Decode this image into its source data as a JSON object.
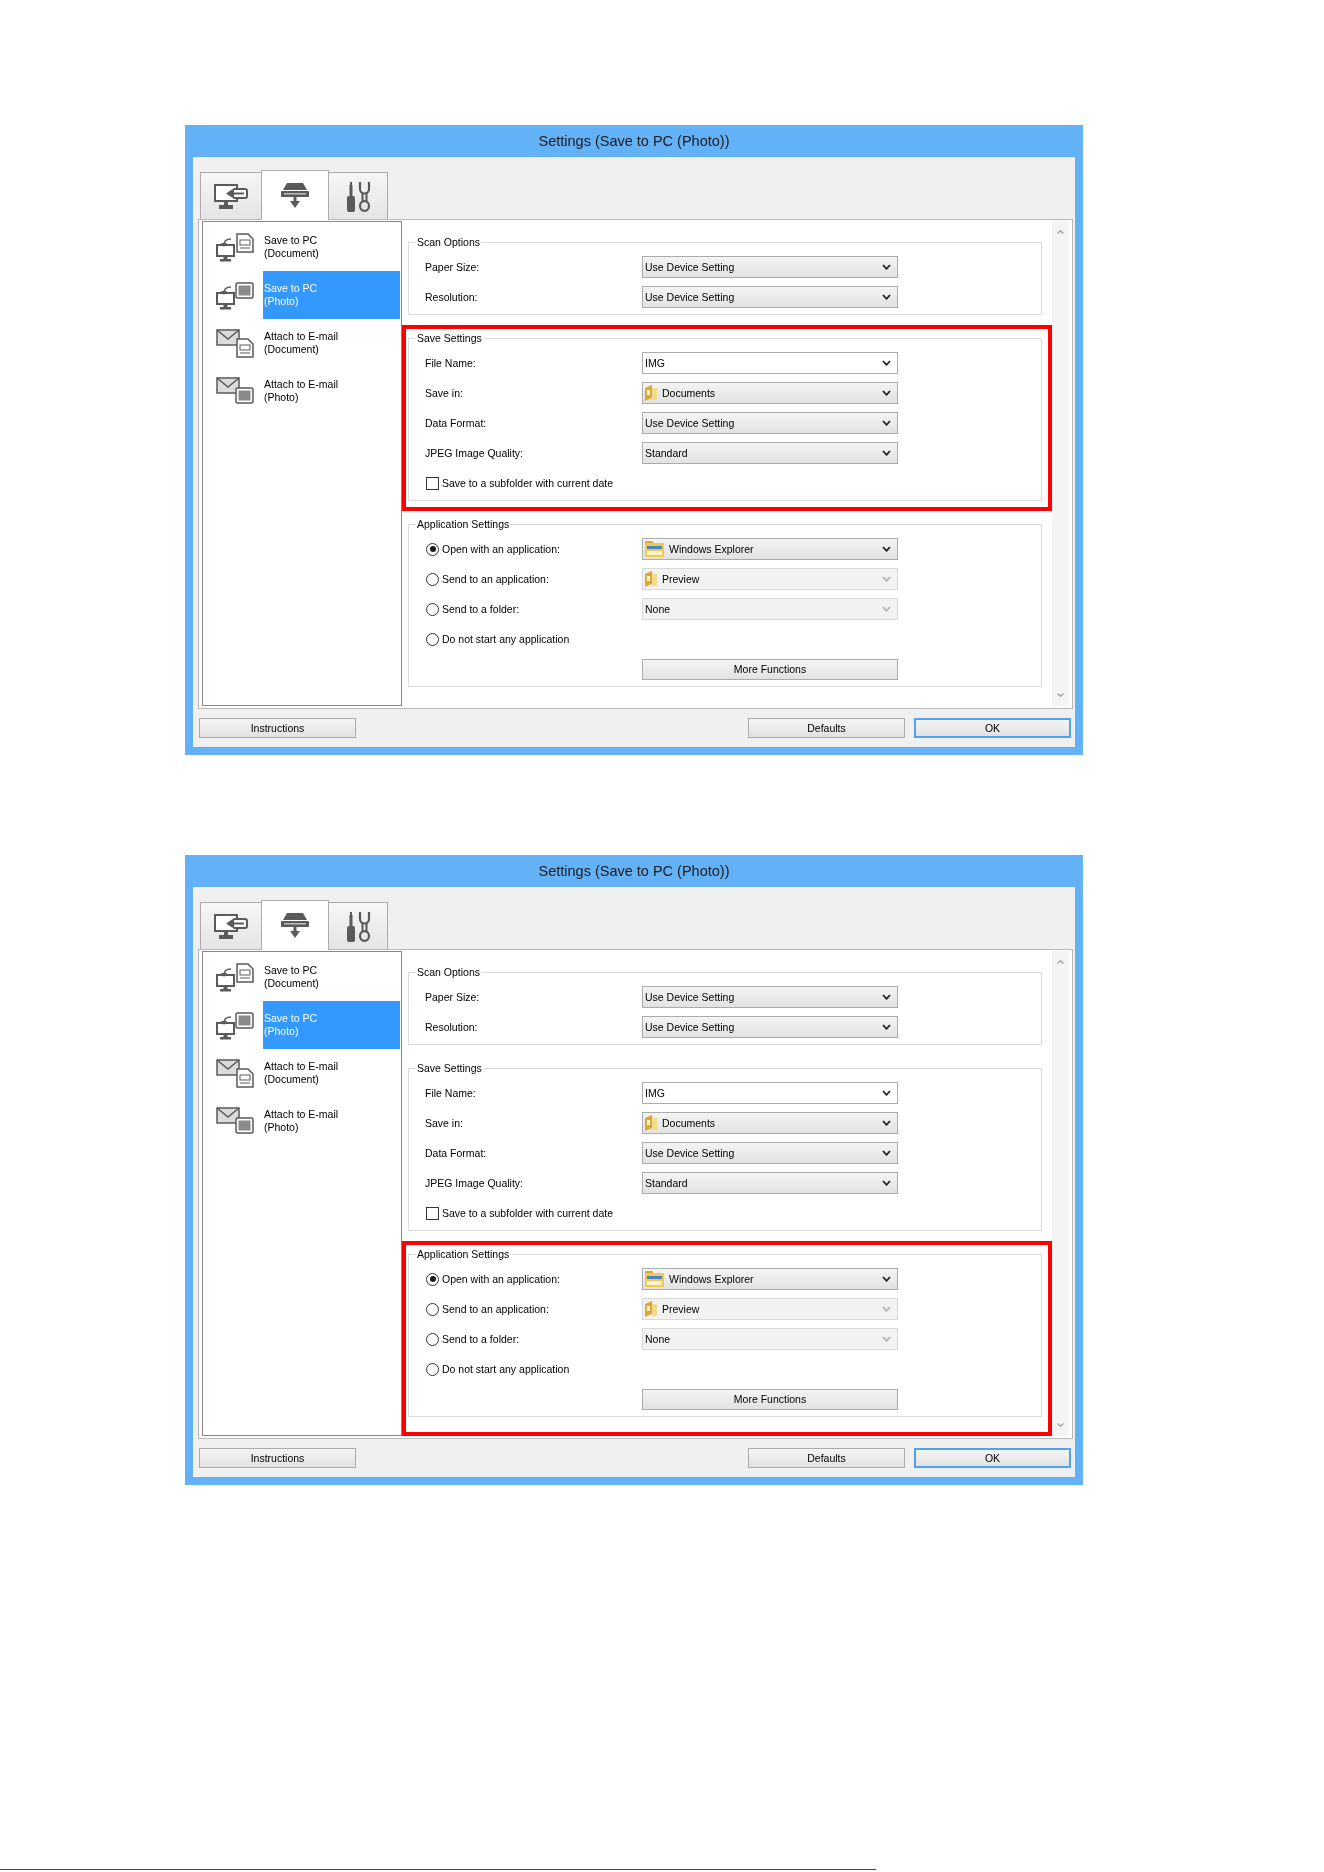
{
  "screens": [
    {
      "window": {
        "title": "Settings (Save to PC (Photo))"
      },
      "tabs": [
        {
          "selected": false
        },
        {
          "selected": true
        },
        {
          "selected": false
        }
      ],
      "sidebar": {
        "items": [
          {
            "title": "Save to PC",
            "subtitle": "(Document)",
            "selected": false
          },
          {
            "title": "Save to PC",
            "subtitle": "(Photo)",
            "selected": true
          },
          {
            "title": "Attach to E-mail",
            "subtitle": "(Document)",
            "selected": false
          },
          {
            "title": "Attach to E-mail",
            "subtitle": "(Photo)",
            "selected": false
          }
        ]
      },
      "scan_options": {
        "title": "Scan Options",
        "highlighted": false,
        "fields": [
          {
            "label": "Paper Size:",
            "kind": "select",
            "value": "Use Device Setting"
          },
          {
            "label": "Resolution:",
            "kind": "select",
            "value": "Use Device Setting"
          }
        ]
      },
      "save_settings": {
        "title": "Save Settings",
        "highlighted": true,
        "fields": [
          {
            "label": "File Name:",
            "kind": "editable",
            "value": "IMG"
          },
          {
            "label": "Save in:",
            "kind": "folder",
            "value": "Documents"
          },
          {
            "label": "Data Format:",
            "kind": "select",
            "value": "Use Device Setting"
          },
          {
            "label": "JPEG Image Quality:",
            "kind": "select",
            "value": "Standard"
          }
        ],
        "checkbox": {
          "label": "Save to a subfolder with current date",
          "checked": false
        }
      },
      "application_settings": {
        "title": "Application Settings",
        "highlighted": false,
        "options": [
          {
            "label": "Open with an application:",
            "selected": true,
            "dropdown": {
              "kind": "explorer",
              "value": "Windows Explorer",
              "disabled": false
            }
          },
          {
            "label": "Send to an application:",
            "selected": false,
            "dropdown": {
              "kind": "folder",
              "value": "Preview",
              "disabled": true
            }
          },
          {
            "label": "Send to a folder:",
            "selected": false,
            "dropdown": {
              "kind": "select",
              "value": "None",
              "disabled": true
            }
          },
          {
            "label": "Do not start any application",
            "selected": false
          }
        ],
        "button": "More Functions"
      },
      "buttons": [
        {
          "label": "Instructions",
          "default": false
        },
        {
          "label": "Defaults",
          "default": false
        },
        {
          "label": "OK",
          "default": true
        }
      ]
    },
    {
      "window": {
        "title": "Settings (Save to PC (Photo))"
      },
      "tabs": [
        {
          "selected": false
        },
        {
          "selected": true
        },
        {
          "selected": false
        }
      ],
      "sidebar": {
        "items": [
          {
            "title": "Save to PC",
            "subtitle": "(Document)",
            "selected": false
          },
          {
            "title": "Save to PC",
            "subtitle": "(Photo)",
            "selected": true
          },
          {
            "title": "Attach to E-mail",
            "subtitle": "(Document)",
            "selected": false
          },
          {
            "title": "Attach to E-mail",
            "subtitle": "(Photo)",
            "selected": false
          }
        ]
      },
      "scan_options": {
        "title": "Scan Options",
        "highlighted": false,
        "fields": [
          {
            "label": "Paper Size:",
            "kind": "select",
            "value": "Use Device Setting"
          },
          {
            "label": "Resolution:",
            "kind": "select",
            "value": "Use Device Setting"
          }
        ]
      },
      "save_settings": {
        "title": "Save Settings",
        "highlighted": false,
        "fields": [
          {
            "label": "File Name:",
            "kind": "editable",
            "value": "IMG"
          },
          {
            "label": "Save in:",
            "kind": "folder",
            "value": "Documents"
          },
          {
            "label": "Data Format:",
            "kind": "select",
            "value": "Use Device Setting"
          },
          {
            "label": "JPEG Image Quality:",
            "kind": "select",
            "value": "Standard"
          }
        ],
        "checkbox": {
          "label": "Save to a subfolder with current date",
          "checked": false
        }
      },
      "application_settings": {
        "title": "Application Settings",
        "highlighted": true,
        "options": [
          {
            "label": "Open with an application:",
            "selected": true,
            "dropdown": {
              "kind": "explorer",
              "value": "Windows Explorer",
              "disabled": false
            }
          },
          {
            "label": "Send to an application:",
            "selected": false,
            "dropdown": {
              "kind": "folder",
              "value": "Preview",
              "disabled": true
            }
          },
          {
            "label": "Send to a folder:",
            "selected": false,
            "dropdown": {
              "kind": "select",
              "value": "None",
              "disabled": true
            }
          },
          {
            "label": "Do not start any application",
            "selected": false
          }
        ],
        "button": "More Functions"
      },
      "buttons": [
        {
          "label": "Instructions",
          "default": false
        },
        {
          "label": "Defaults",
          "default": false
        },
        {
          "label": "OK",
          "default": true
        }
      ]
    }
  ]
}
